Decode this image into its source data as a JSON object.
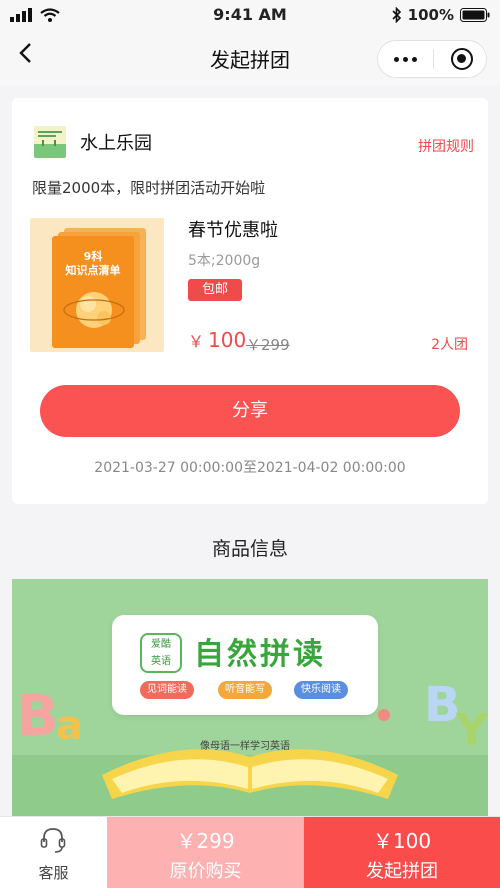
{
  "status_bar": {
    "time": "9:41 AM",
    "battery": "100%"
  },
  "nav": {
    "title": "发起拼团"
  },
  "shop": {
    "name": "水上乐园",
    "rules_link": "拼团规则"
  },
  "promo_text": "限量2000本，限时拼团活动开始啦",
  "product": {
    "name": "春节优惠啦",
    "spec": "5本;2000g",
    "badge": "包邮",
    "currency": "￥",
    "price": "100",
    "original_price": "￥299",
    "group_size": "2人团",
    "cover_line1": "9科",
    "cover_line2": "知识点清单"
  },
  "share_button": "分享",
  "period": "2021-03-27 00:00:00至2021-04-02 00:00:00",
  "section_title": "商品信息",
  "banner": {
    "tag_line1": "爱酷",
    "tag_line2": "英语",
    "title": "自然拼读",
    "features": [
      "见词能读",
      "听音能写",
      "快乐阅读"
    ],
    "subtitle": "像母语一样学习英语"
  },
  "bottom_bar": {
    "service_label": "客服",
    "original_price": "￥299",
    "original_label": "原价购买",
    "group_price": "￥100",
    "group_label": "发起拼团"
  },
  "colors": {
    "accent": "#fb4c4c",
    "accent_light": "#fdb1b1",
    "banner_green": "#9fd59b"
  }
}
